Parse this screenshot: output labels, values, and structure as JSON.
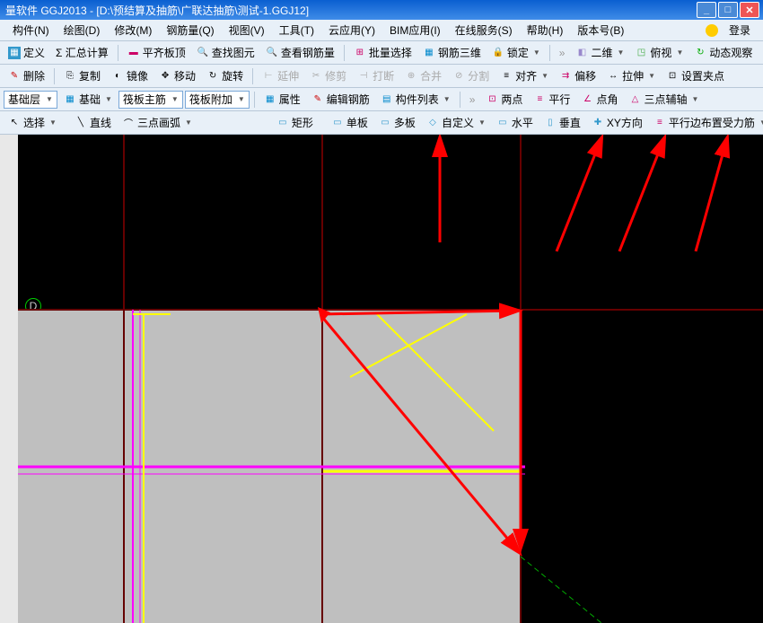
{
  "title": "量软件 GGJ2013 - [D:\\预结算及抽筋\\广联达抽筋\\测试-1.GGJ12]",
  "menus": {
    "m1": "构件(N)",
    "m2": "绘图(D)",
    "m3": "修改(M)",
    "m4": "钢筋量(Q)",
    "m5": "视图(V)",
    "m6": "工具(T)",
    "m7": "云应用(Y)",
    "m8": "BIM应用(I)",
    "m9": "在线服务(S)",
    "m10": "帮助(H)",
    "m11": "版本号(B)",
    "login": "登录"
  },
  "row1": {
    "b1": "定义",
    "b2": "Σ 汇总计算",
    "b3": "平齐板顶",
    "b4": "查找图元",
    "b5": "查看钢筋量",
    "b6": "批量选择",
    "b7": "钢筋三维",
    "b8": "锁定",
    "b9": "二维",
    "b10": "俯视",
    "b11": "动态观察"
  },
  "row2": {
    "b1": "删除",
    "b2": "复制",
    "b3": "镜像",
    "b4": "移动",
    "b5": "旋转",
    "b6": "延伸",
    "b7": "修剪",
    "b8": "打断",
    "b9": "合并",
    "b10": "分割",
    "b11": "对齐",
    "b12": "偏移",
    "b13": "拉伸",
    "b14": "设置夹点"
  },
  "row3": {
    "s1": "基础层",
    "s2": "基础",
    "s3": "筏板主筋",
    "s4": "筏板附加",
    "b1": "属性",
    "b2": "编辑钢筋",
    "b3": "构件列表",
    "b4": "两点",
    "b5": "平行",
    "b6": "点角",
    "b7": "三点辅轴"
  },
  "row4": {
    "b1": "选择",
    "b2": "直线",
    "b3": "三点画弧",
    "b4": "矩形",
    "b5": "单板",
    "b6": "多板",
    "b7": "自定义",
    "b8": "水平",
    "b9": "垂直",
    "b10": "XY方向",
    "b11": "平行边布置受力筋"
  },
  "canvas": {
    "point_label": "D"
  }
}
